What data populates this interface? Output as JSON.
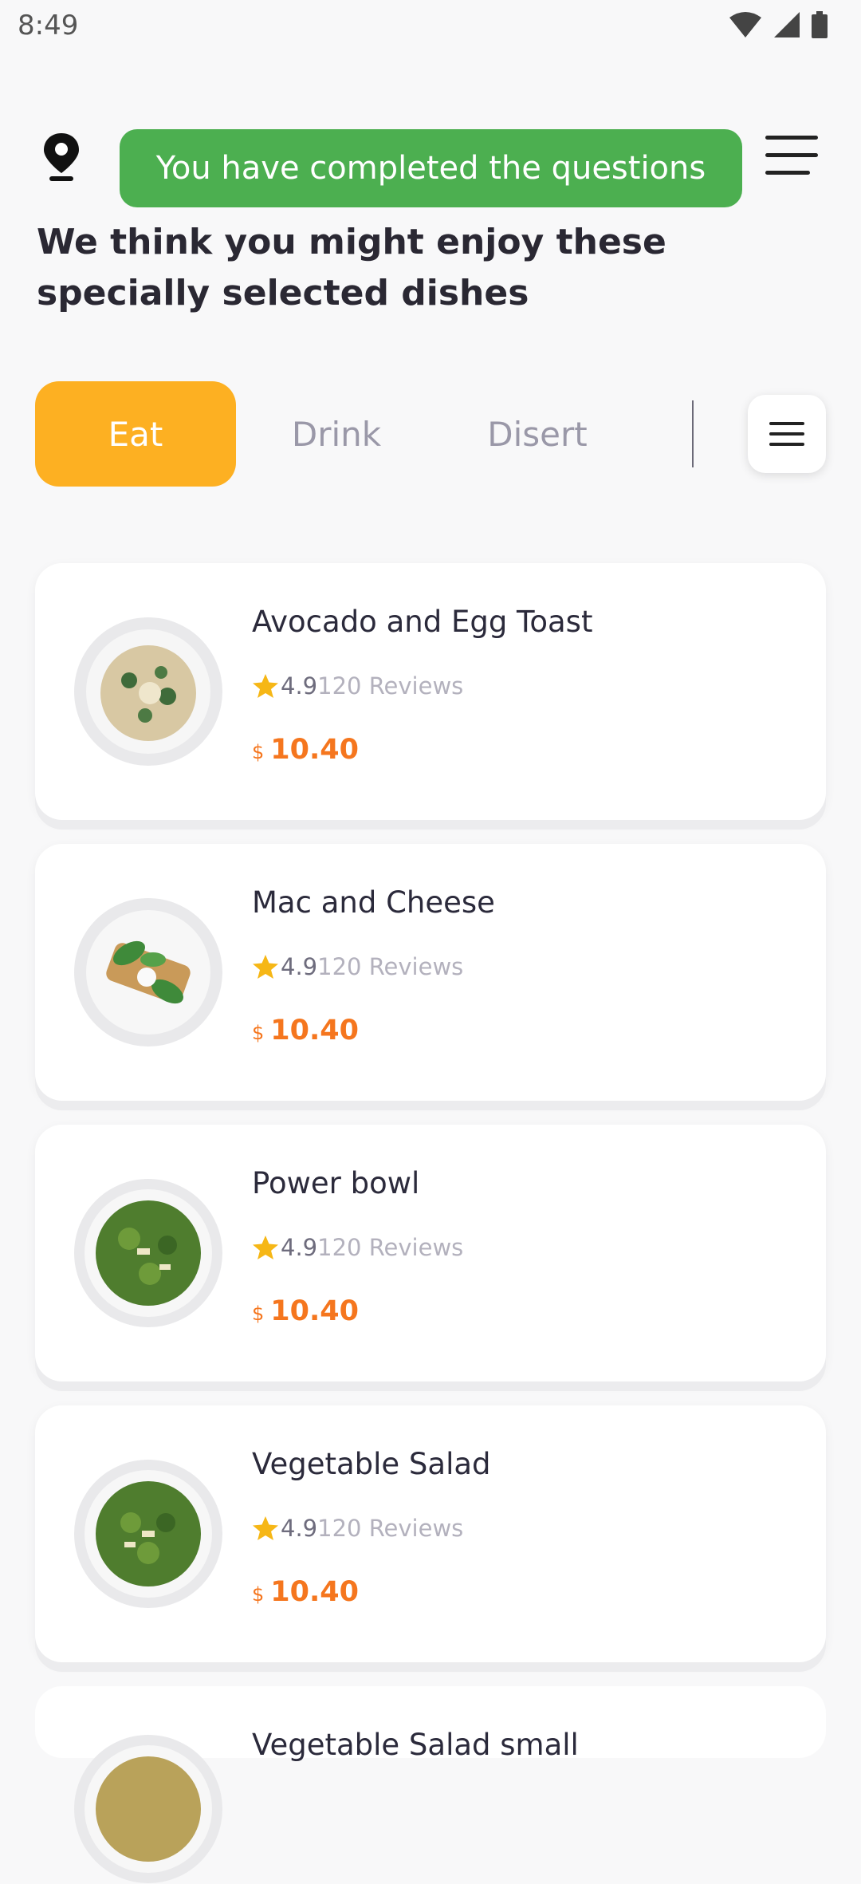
{
  "status_bar": {
    "time": "8:49"
  },
  "toast": {
    "message": "You have completed the questions"
  },
  "heading": "We think you might enjoy these specially selected dishes",
  "tabs": [
    {
      "label": "Eat",
      "active": true
    },
    {
      "label": "Drink",
      "active": false
    },
    {
      "label": "Disert",
      "active": false
    }
  ],
  "dishes": [
    {
      "name": "Avocado and Egg Toast",
      "rating": "4.9",
      "reviews": "120 Reviews",
      "currency": "$",
      "price": "10.40"
    },
    {
      "name": "Mac and Cheese",
      "rating": "4.9",
      "reviews": "120 Reviews",
      "currency": "$",
      "price": "10.40"
    },
    {
      "name": "Power bowl",
      "rating": "4.9",
      "reviews": "120 Reviews",
      "currency": "$",
      "price": "10.40"
    },
    {
      "name": "Vegetable Salad",
      "rating": "4.9",
      "reviews": "120 Reviews",
      "currency": "$",
      "price": "10.40"
    },
    {
      "name": "Vegetable Salad small"
    }
  ],
  "colors": {
    "accent": "#fdb022",
    "toast": "#4caf50",
    "price": "#f5761e",
    "star": "#f6b716"
  },
  "icons": [
    "location-pin-icon",
    "hamburger-menu-icon",
    "filter-menu-icon",
    "star-icon",
    "wifi-icon",
    "signal-icon",
    "battery-icon"
  ]
}
